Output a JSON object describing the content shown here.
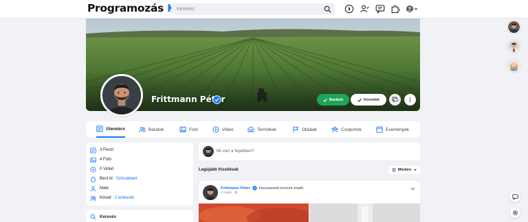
{
  "header": {
    "logo_main": "Programozás",
    "logo_accent": "Kft.",
    "search_placeholder": "Keresés",
    "icons": [
      "search-icon",
      "compass-icon",
      "friends-icon",
      "messages-icon",
      "puzzle-icon",
      "user-menu-icon"
    ]
  },
  "profile": {
    "name": "Frittmann Péter",
    "verified": true,
    "friends_button": "Barátok",
    "follow_button": "Követlek",
    "cover_colors": {
      "sky": "#c9d6dc",
      "field": "#4d7a34",
      "soil": "#3b5a2a"
    }
  },
  "tabs": [
    {
      "label": "Ütemterv",
      "icon": "timeline-icon",
      "active": true
    },
    {
      "label": "Barátok",
      "icon": "friends-icon"
    },
    {
      "label": "Fotó",
      "icon": "photo-icon"
    },
    {
      "label": "Videó",
      "icon": "video-icon"
    },
    {
      "label": "Termékek",
      "icon": "products-icon"
    },
    {
      "label": "Oldalak",
      "icon": "flag-icon"
    },
    {
      "label": "Csoportok",
      "icon": "groups-icon"
    },
    {
      "label": "Események",
      "icon": "calendar-icon"
    }
  ],
  "intro": {
    "posts": "3 Poszt",
    "photos": "4 Fotó",
    "videos": "0 Videó",
    "lives_prefix": "Bent él",
    "lives_place": "Szlovákiaet",
    "gender": "Male",
    "follows_prefix": "Követi",
    "follows_link": "2 emberek"
  },
  "search_card": {
    "label": "Keresés"
  },
  "composer": {
    "placeholder": "Mi van a fejedben?"
  },
  "feed": {
    "title": "Legújabb frissítések",
    "filter": "Minden"
  },
  "post": {
    "author": "Frittmann Péter",
    "action": "Hozzáadott termék eladó",
    "time": "3 napja"
  },
  "colors": {
    "accent": "#1877f2",
    "green": "#1fa45c",
    "background": "#f0f2f5"
  }
}
